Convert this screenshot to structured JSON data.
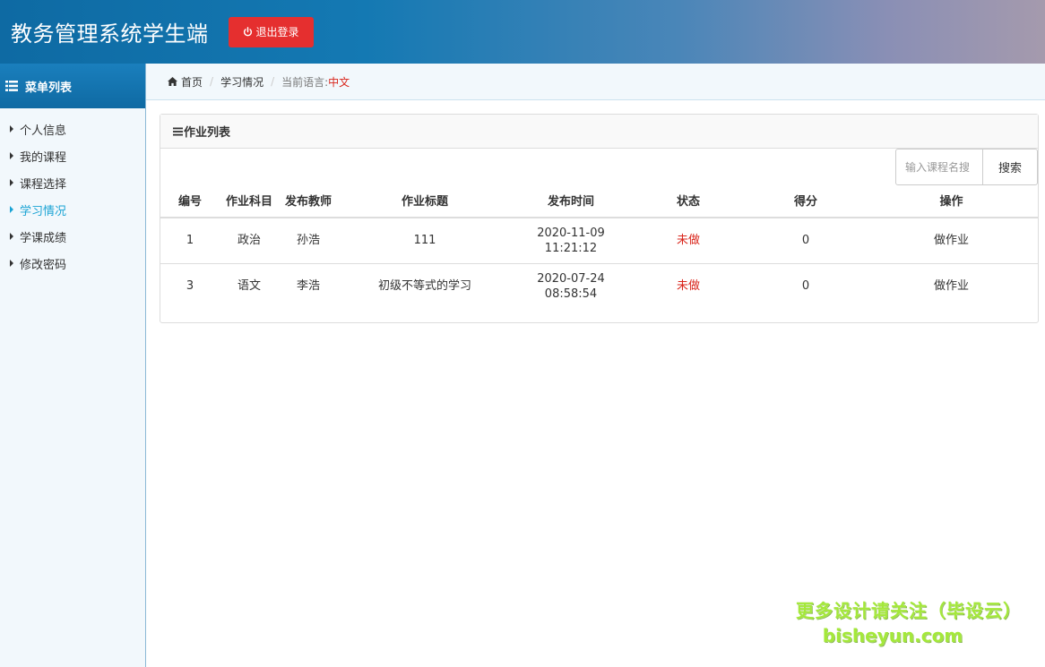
{
  "header": {
    "title": "教务管理系统学生端",
    "logout_label": "退出登录"
  },
  "sidebar": {
    "title": "菜单列表",
    "items": [
      {
        "label": "个人信息"
      },
      {
        "label": "我的课程"
      },
      {
        "label": "课程选择"
      },
      {
        "label": "学习情况"
      },
      {
        "label": "学课成绩"
      },
      {
        "label": "修改密码"
      }
    ],
    "active_index": 3
  },
  "breadcrumb": {
    "home": "首页",
    "current": "学习情况",
    "lang_label": "当前语言:",
    "lang_value": "中文"
  },
  "panel": {
    "title": "作业列表",
    "search_placeholder": "输入课程名搜",
    "search_button": "搜索"
  },
  "table": {
    "headers": [
      "编号",
      "作业科目",
      "发布教师",
      "作业标题",
      "发布时间",
      "状态",
      "得分",
      "操作"
    ],
    "rows": [
      {
        "id": "1",
        "subject": "政治",
        "teacher": "孙浩",
        "title": "111",
        "date": "2020-11-09",
        "time": "11:21:12",
        "status": "未做",
        "score": "0",
        "action": "做作业"
      },
      {
        "id": "3",
        "subject": "语文",
        "teacher": "李浩",
        "title": "初级不等式的学习",
        "date": "2020-07-24",
        "time": "08:58:54",
        "status": "未做",
        "score": "0",
        "action": "做作业"
      }
    ]
  },
  "watermark": {
    "line1": "更多设计请关注（毕设云）",
    "line2": "bisheyun.com"
  },
  "colors": {
    "accent": "#1479b3",
    "danger": "#e52f2f",
    "status_todo": "#d9261c",
    "active_menu": "#1aa3d4"
  }
}
